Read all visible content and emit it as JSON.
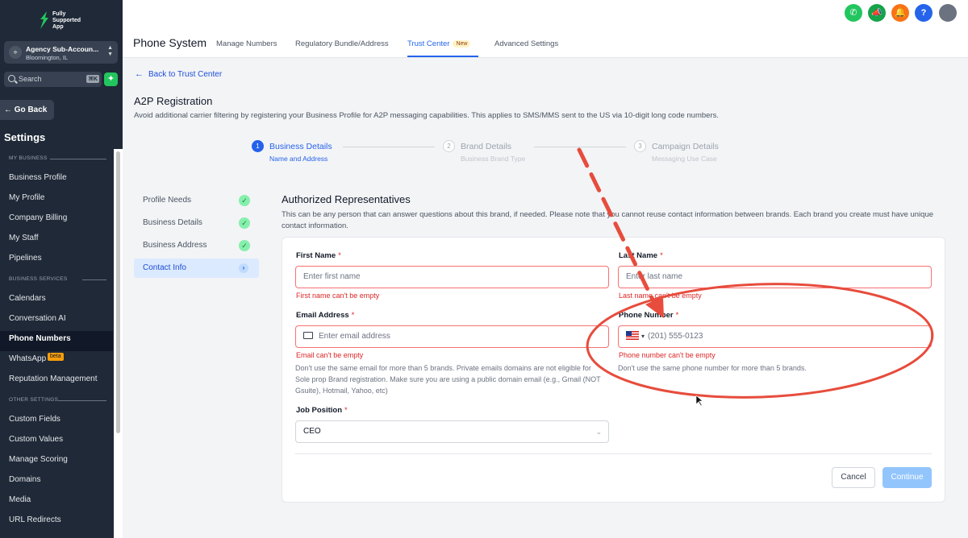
{
  "brand": {
    "logo_text": "Fully Supported App"
  },
  "account": {
    "name": "Agency Sub-Accoun...",
    "location": "Bloomington, IL"
  },
  "search": {
    "placeholder": "Search",
    "shortcut": "⌘K"
  },
  "sidebar": {
    "go_back": "Go Back",
    "settings_title": "Settings",
    "sections": [
      {
        "label": "MY BUSINESS",
        "items": [
          "Business Profile",
          "My Profile",
          "Company Billing",
          "My Staff",
          "Pipelines"
        ]
      },
      {
        "label": "BUSINESS SERVICES",
        "items": [
          "Calendars",
          "Conversation AI",
          "Phone Numbers",
          "WhatsApp",
          "Reputation Management"
        ]
      },
      {
        "label": "OTHER SETTINGS",
        "items": [
          "Custom Fields",
          "Custom Values",
          "Manage Scoring",
          "Domains",
          "Media",
          "URL Redirects"
        ]
      }
    ],
    "active_item": "Phone Numbers",
    "beta_badge": "beta"
  },
  "topbar": {
    "icons": [
      {
        "name": "phone-icon",
        "color": "#22c55e"
      },
      {
        "name": "megaphone-icon",
        "color": "#16a34a"
      },
      {
        "name": "bell-icon",
        "color": "#f97316"
      },
      {
        "name": "help-icon",
        "color": "#2563eb"
      },
      {
        "name": "avatar",
        "color": "#6b7280"
      }
    ]
  },
  "tabbar": {
    "title": "Phone System",
    "tabs": [
      "Manage Numbers",
      "Regulatory Bundle/Address",
      "Trust Center",
      "Advanced Settings"
    ],
    "active_tab": "Trust Center",
    "new_badge": "New"
  },
  "main": {
    "back_link": "Back to Trust Center",
    "title": "A2P Registration",
    "description": "Avoid additional carrier filtering by registering your Business Profile for A2P messaging capabilities. This applies to SMS/MMS sent to the US via 10-digit long code numbers."
  },
  "stepper": [
    {
      "num": "1",
      "title": "Business Details",
      "subtitle": "Name and Address",
      "state": "active"
    },
    {
      "num": "2",
      "title": "Brand Details",
      "subtitle": "Business Brand Type",
      "state": "inactive"
    },
    {
      "num": "3",
      "title": "Campaign Details",
      "subtitle": "Messaging Use Case",
      "state": "inactive"
    }
  ],
  "side_steps": [
    {
      "label": "Profile Needs",
      "state": "done"
    },
    {
      "label": "Business Details",
      "state": "done"
    },
    {
      "label": "Business Address",
      "state": "done"
    },
    {
      "label": "Contact Info",
      "state": "active"
    }
  ],
  "form": {
    "section_title": "Authorized Representatives",
    "section_desc": "This can be any person that can answer questions about this brand, if needed. Please note that you cannot reuse contact information between brands. Each brand you create must have unique contact information.",
    "required_mark": "*",
    "first_name": {
      "label": "First Name",
      "placeholder": "Enter first name",
      "error": "First name can't be empty"
    },
    "last_name": {
      "label": "Last Name",
      "placeholder": "Enter last name",
      "error": "Last name can't be empty"
    },
    "email": {
      "label": "Email Address",
      "placeholder": "Enter email address",
      "error": "Email can't be empty",
      "hint": "Don't use the same email for more than 5 brands. Private emails domains are not eligible for Sole prop Brand registration. Make sure you are using a public domain email (e.g., Gmail (NOT Gsuite), Hotmail, Yahoo, etc)"
    },
    "phone": {
      "label": "Phone Number",
      "placeholder": "(201) 555-0123",
      "error": "Phone number can't be empty",
      "hint": "Don't use the same phone number for more than 5 brands."
    },
    "job_position": {
      "label": "Job Position",
      "value": "CEO"
    },
    "cancel": "Cancel",
    "continue": "Continue"
  },
  "colors": {
    "accent": "#2563eb",
    "error": "#dc2626",
    "annotation": "#e74c3c"
  }
}
